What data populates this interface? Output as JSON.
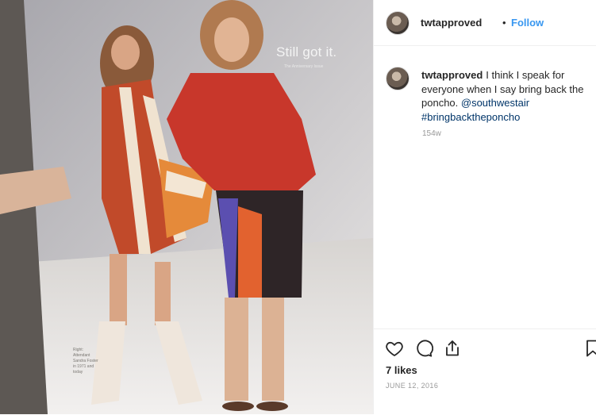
{
  "photo": {
    "headline": "Still got it.",
    "headline_sub": "The Anniversary Issue",
    "caption": "Right: Attendant Sandra Foster in 1971 and today"
  },
  "post": {
    "username": "twtapproved",
    "separator": "•",
    "follow_label": "Follow",
    "comment": {
      "username": "twtapproved",
      "text": "I think I speak for everyone when I say bring back the poncho. ",
      "mention": "@southwestair",
      "hashtag": "#bringbacktheponcho"
    },
    "relative_time": "154w",
    "likes": "7 likes",
    "date": "JUNE 12, 2016"
  },
  "icons": {
    "like": "heart-icon",
    "comment": "comment-icon",
    "share": "share-icon",
    "save": "bookmark-icon"
  }
}
